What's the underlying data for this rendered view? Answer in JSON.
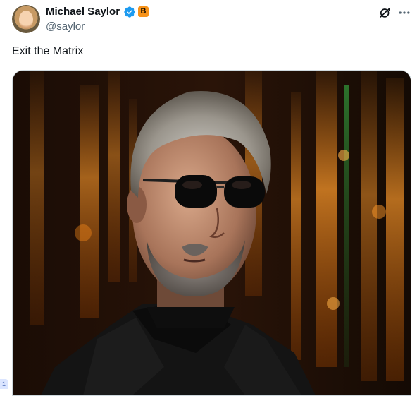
{
  "author": {
    "name": "Michael Saylor",
    "handle": "@saylor",
    "verified_icon": "verified-badge-icon",
    "affiliate_badge": "B",
    "affiliate_badge_color": "#f7931a"
  },
  "header_actions": {
    "grok_icon": "grok-icon",
    "more_icon": "more-icon"
  },
  "tweet": {
    "text": "Exit the Matrix",
    "media_icon": "media-image"
  },
  "side_chip": {
    "label": "1"
  },
  "colors": {
    "accent_blue": "#1d9bf0",
    "text": "#0f1419",
    "secondary_text": "#536471"
  }
}
